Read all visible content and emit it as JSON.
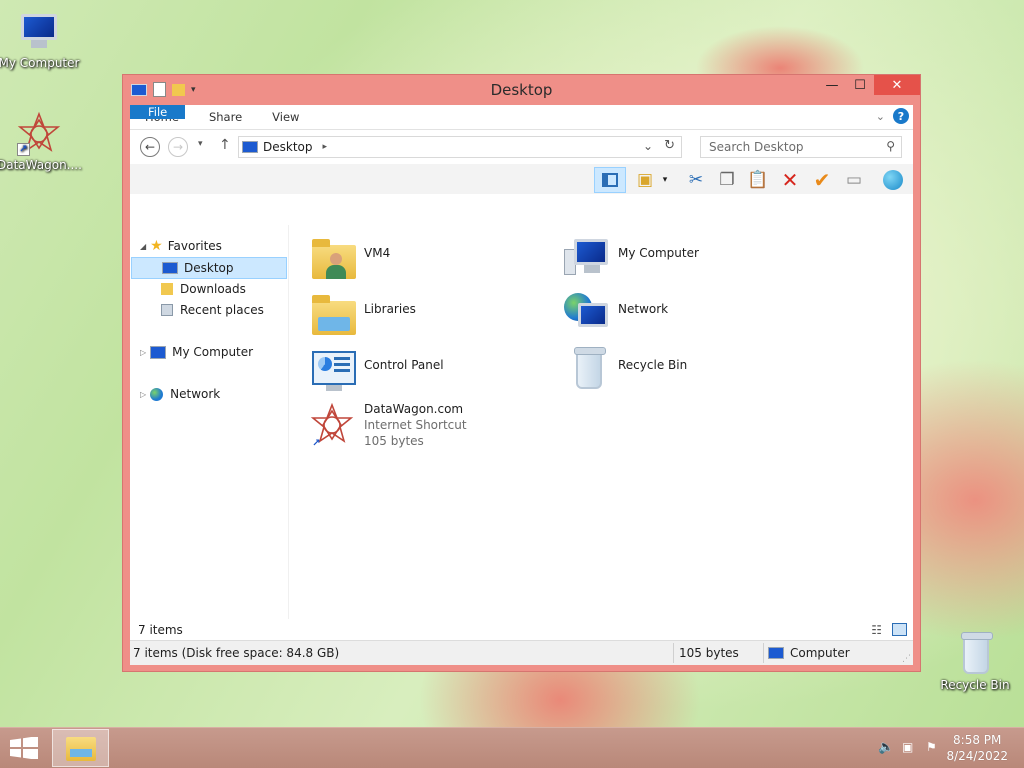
{
  "desktop": {
    "icons": [
      {
        "label": "My Computer",
        "icon": "computer-icon"
      },
      {
        "label": "DataWagon....",
        "icon": "internet-shortcut-icon"
      },
      {
        "label": "Recycle Bin",
        "icon": "recycle-bin-icon"
      }
    ]
  },
  "window": {
    "title": "Desktop",
    "controls": {
      "minimize": "—",
      "maximize": "☐",
      "close": "✕"
    },
    "ribbon_tabs": [
      "File",
      "Home",
      "Share",
      "View"
    ],
    "help_label": "?",
    "address": {
      "location": "Desktop"
    },
    "search": {
      "placeholder": "Search Desktop"
    },
    "nav_pane": {
      "favorites_label": "Favorites",
      "favorites": [
        "Desktop",
        "Downloads",
        "Recent places"
      ],
      "my_computer": "My Computer",
      "network": "Network"
    },
    "files": [
      {
        "name": "VM4",
        "icon": "user-folder-icon"
      },
      {
        "name": "My Computer",
        "icon": "computer-icon"
      },
      {
        "name": "Libraries",
        "icon": "libraries-folder-icon"
      },
      {
        "name": "Network",
        "icon": "network-icon"
      },
      {
        "name": "Control Panel",
        "icon": "control-panel-icon"
      },
      {
        "name": "Recycle Bin",
        "icon": "recycle-bin-icon"
      },
      {
        "name": "DataWagon.com",
        "type": "Internet Shortcut",
        "size": "105 bytes",
        "icon": "internet-shortcut-icon"
      }
    ],
    "item_count": "7 items",
    "statusbar": {
      "left": "7 items (Disk free space: 84.8 GB)",
      "middle": "105 bytes",
      "right": "Computer"
    }
  },
  "taskbar": {
    "time": "8:58 PM",
    "date": "8/24/2022"
  },
  "colors": {
    "window_frame": "#ef8f88",
    "accent_blue": "#1979ca",
    "selection": "#cce8ff",
    "close_button": "#e5524a"
  }
}
